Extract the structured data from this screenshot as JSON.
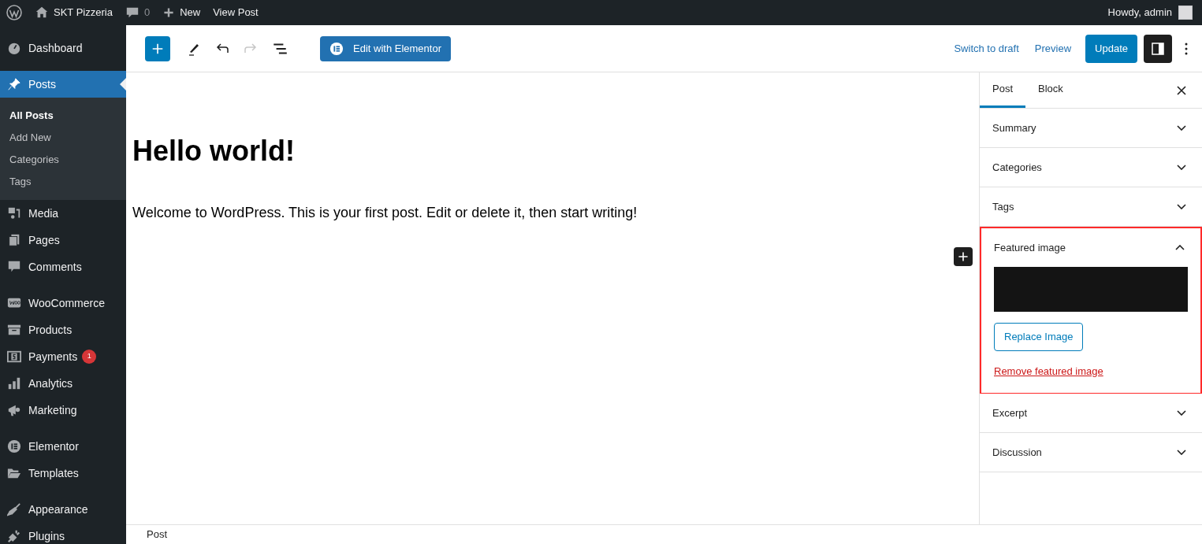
{
  "admin_bar": {
    "site_name": "SKT Pizzeria",
    "comments_count": "0",
    "new_label": "New",
    "view_post_label": "View Post",
    "greeting": "Howdy, admin"
  },
  "sidebar": {
    "groups": [
      [
        {
          "label": "Dashboard",
          "selected": false
        }
      ],
      [
        {
          "label": "Posts",
          "selected": true,
          "children": [
            {
              "label": "All Posts",
              "selected": true
            },
            {
              "label": "Add New",
              "selected": false
            },
            {
              "label": "Categories",
              "selected": false
            },
            {
              "label": "Tags",
              "selected": false
            }
          ]
        },
        {
          "label": "Media",
          "selected": false
        },
        {
          "label": "Pages",
          "selected": false
        },
        {
          "label": "Comments",
          "selected": false
        }
      ],
      [
        {
          "label": "WooCommerce",
          "selected": false
        },
        {
          "label": "Products",
          "selected": false
        },
        {
          "label": "Payments",
          "selected": false,
          "badge": "1"
        },
        {
          "label": "Analytics",
          "selected": false
        },
        {
          "label": "Marketing",
          "selected": false
        }
      ],
      [
        {
          "label": "Elementor",
          "selected": false
        },
        {
          "label": "Templates",
          "selected": false
        }
      ],
      [
        {
          "label": "Appearance",
          "selected": false
        },
        {
          "label": "Plugins",
          "selected": false
        }
      ]
    ]
  },
  "toolbar": {
    "redo_disabled": true,
    "elementor_button": "Edit with Elementor",
    "switch_to_draft": "Switch to draft",
    "preview": "Preview",
    "update": "Update",
    "settings_open": true
  },
  "editor": {
    "title": "Hello world!",
    "paragraph": "Welcome to WordPress. This is your first post. Edit or delete it, then start writing!"
  },
  "settings": {
    "tabs": [
      {
        "label": "Post",
        "selected": true
      },
      {
        "label": "Block",
        "selected": false
      }
    ],
    "panels": [
      {
        "title": "Summary",
        "expanded": false,
        "highlighted": false
      },
      {
        "title": "Categories",
        "expanded": false,
        "highlighted": false
      },
      {
        "title": "Tags",
        "expanded": false,
        "highlighted": false
      },
      {
        "title": "Featured image",
        "expanded": true,
        "highlighted": true,
        "replace_button": "Replace Image",
        "remove_link": "Remove featured image"
      },
      {
        "title": "Excerpt",
        "expanded": false,
        "highlighted": false
      },
      {
        "title": "Discussion",
        "expanded": false,
        "highlighted": false
      }
    ]
  },
  "footer": {
    "breadcrumb": "Post"
  }
}
